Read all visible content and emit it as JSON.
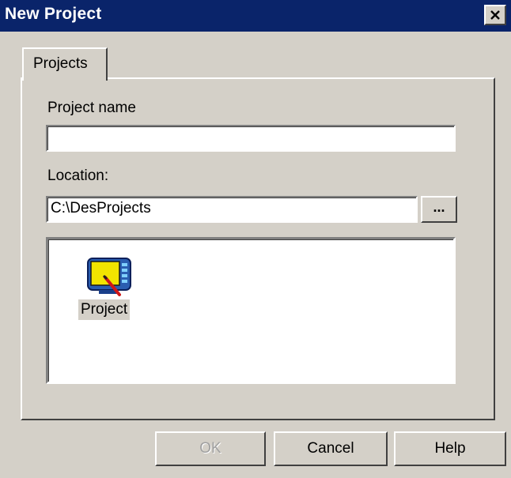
{
  "window": {
    "title": "New Project",
    "close_glyph": "✕"
  },
  "tabs": [
    {
      "label": "Projects"
    }
  ],
  "form": {
    "project_name_label": "Project name",
    "project_name_value": "",
    "location_label": "Location:",
    "location_value": "C:\\DesProjects",
    "browse_label": "..."
  },
  "templates": [
    {
      "label": "Project",
      "icon": "project-monitor-icon",
      "selected": true
    }
  ],
  "buttons": {
    "ok": "OK",
    "cancel": "Cancel",
    "help": "Help"
  },
  "colors": {
    "titlebar": "#0a246a",
    "face": "#d4d0c8"
  }
}
